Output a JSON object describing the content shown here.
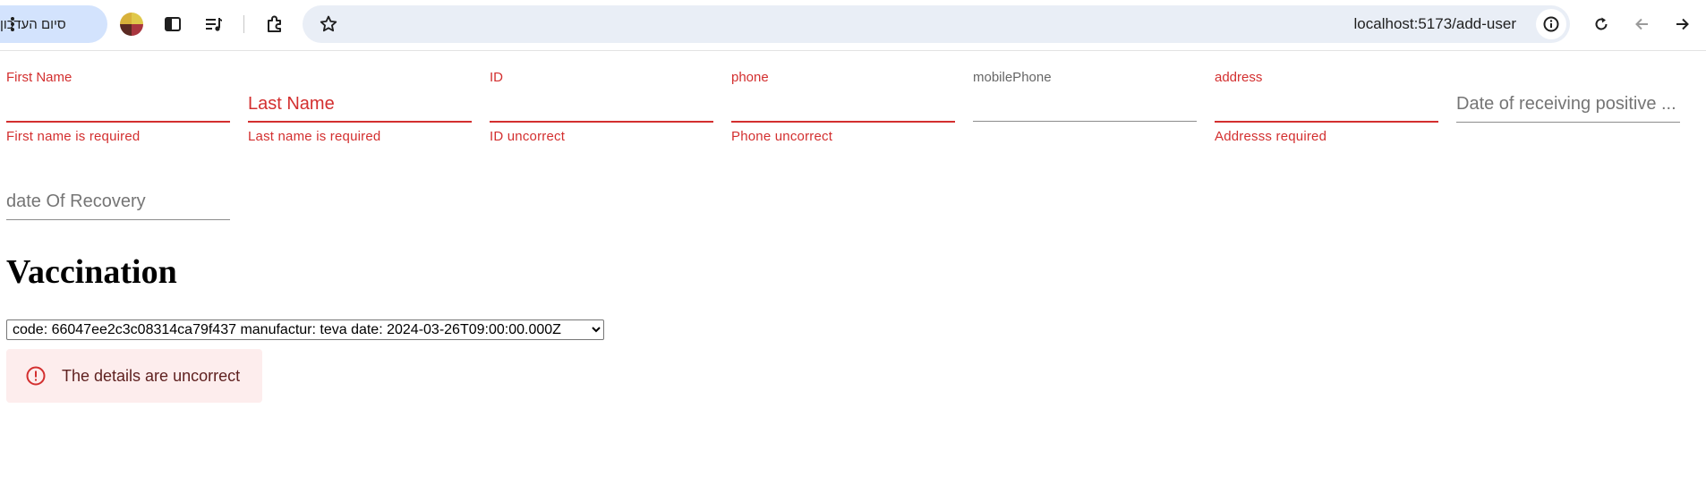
{
  "browser": {
    "update_chip_label": "סיום העדכון",
    "url": "localhost:5173/add-user",
    "icons": [
      "kebab-menu-icon",
      "profile-avatar",
      "side-panel-icon",
      "media-control-icon",
      "extensions-icon",
      "bookmark-star-icon",
      "site-info-icon",
      "reload-icon",
      "back-arrow-icon",
      "forward-arrow-icon"
    ]
  },
  "form": {
    "first_name": {
      "label": "First Name",
      "helper": "First name is required"
    },
    "last_name": {
      "placeholder": "Last Name",
      "helper": "Last name is required"
    },
    "id": {
      "label": "ID",
      "helper": "ID uncorrect"
    },
    "phone": {
      "label": "phone",
      "helper": "Phone uncorrect"
    },
    "mobile_phone": {
      "label": "mobilePhone"
    },
    "address": {
      "label": "address",
      "helper": "Addresss required"
    },
    "date_positive": {
      "placeholder": "Date of receiving positive ..."
    },
    "date_recovery": {
      "placeholder": "date Of Recovery"
    }
  },
  "vaccination": {
    "heading": "Vaccination",
    "selected_option": "code: 66047ee2c3c08314ca79f437 manufactur: teva date: 2024-03-26T09:00:00.000Z"
  },
  "alert": {
    "message": "The details are uncorrect",
    "severity": "error"
  },
  "colors": {
    "error": "#d32f2f",
    "alert_bg": "#fdeded",
    "alert_text": "#5f2120",
    "chip_bg": "#d3e3fd",
    "omnibox_bg": "#e9eef6"
  }
}
